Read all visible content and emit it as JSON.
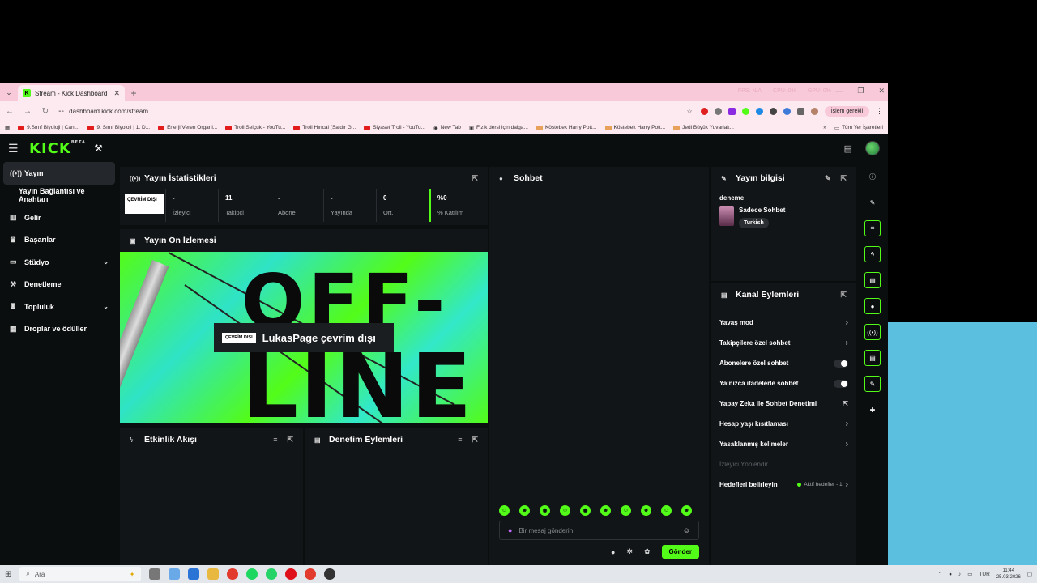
{
  "browser": {
    "tab_title": "Stream - Kick Dashboard",
    "url": "dashboard.kick.com/stream",
    "profile_label": "İşlem gerekli",
    "perf": [
      "FPS: N/A",
      "CPU: 0%",
      "GPU: 0%"
    ],
    "bookmarks": [
      {
        "label": "9.Sınıf Biyoloji | Canl...",
        "icon": "youtube"
      },
      {
        "label": "9. Sınıf Biyoloji | 1. D...",
        "icon": "youtube"
      },
      {
        "label": "Enerji Veren Organi...",
        "icon": "youtube"
      },
      {
        "label": "Troll Selçuk - YouTu...",
        "icon": "youtube"
      },
      {
        "label": "Troll Hıncal (Saldır G...",
        "icon": "youtube"
      },
      {
        "label": "Siyaset Troll - YouTu...",
        "icon": "youtube"
      },
      {
        "label": "New Tab",
        "icon": "chrome"
      },
      {
        "label": "Fizik dersi için dalga...",
        "icon": "doc"
      },
      {
        "label": "Köstebek Harry Pott...",
        "icon": "folder"
      },
      {
        "label": "Köstebek Harry Pott...",
        "icon": "folder"
      },
      {
        "label": "Jedi Büyük Yuvarlak...",
        "icon": "folder"
      }
    ],
    "bookmarks_all": "Tüm Yer İşaretleri"
  },
  "app": {
    "logo": "KICK",
    "logo_badge": "BETA"
  },
  "sidebar": {
    "items": [
      {
        "label": "Yayın",
        "icon": "broadcast-icon"
      },
      {
        "label": "Yayın Bağlantısı ve Anahtarı",
        "icon": ""
      },
      {
        "label": "Gelir",
        "icon": "chart-icon"
      },
      {
        "label": "Başarılar",
        "icon": "trophy-icon"
      },
      {
        "label": "Stüdyo",
        "icon": "studio-icon"
      },
      {
        "label": "Denetleme",
        "icon": "hammer-icon"
      },
      {
        "label": "Topluluk",
        "icon": "community-icon"
      },
      {
        "label": "Droplar ve ödüller",
        "icon": "gift-icon"
      }
    ]
  },
  "stats": {
    "title": "Yayın İstatistikleri",
    "status_badge": "ÇEVRİM DIŞI",
    "items": [
      {
        "value": "-",
        "label": "İzleyici"
      },
      {
        "value": "11",
        "label": "Takipçi"
      },
      {
        "value": "-",
        "label": "Abone"
      },
      {
        "value": "-",
        "label": "Yayında"
      },
      {
        "value": "0",
        "label": "Ort."
      },
      {
        "value": "%0",
        "label": "% Katılım"
      }
    ]
  },
  "preview": {
    "title": "Yayın Ön İzlemesi",
    "chip": "ÇEVRİM DIŞI",
    "offline_text": "LukasPage çevrim dışı",
    "art_top": "OFF-",
    "art_bottom": "LINE"
  },
  "activity": {
    "title": "Etkinlik Akışı"
  },
  "modactions": {
    "title": "Denetim Eylemleri"
  },
  "chat": {
    "title": "Sohbet",
    "placeholder": "Bir mesaj gönderin",
    "send_label": "Gönder"
  },
  "stream_info": {
    "title": "Yayın bilgisi",
    "stream_title": "deneme",
    "category": "Sadece Sohbet",
    "tag": "Turkish"
  },
  "channel_actions": {
    "title": "Kanal Eylemleri",
    "rows": [
      {
        "label": "Yavaş mod",
        "control": "arrow"
      },
      {
        "label": "Takipçilere özel sohbet",
        "control": "arrow"
      },
      {
        "label": "Abonelere özel sohbet",
        "control": "toggle"
      },
      {
        "label": "Yalnızca ifadelerle sohbet",
        "control": "toggle"
      },
      {
        "label": "Yapay Zeka ile Sohbet Denetimi",
        "control": "external"
      },
      {
        "label": "Hesap yaşı kısıtlaması",
        "control": "arrow"
      },
      {
        "label": "Yasaklanmış kelimeler",
        "control": "arrow"
      }
    ],
    "muted_row": "İzleyici Yönlendir",
    "goals_label": "Hedefleri belirleyin",
    "goals_status": "Aktif hedefler - 1"
  },
  "taskbar": {
    "search": "Ara",
    "lang": "TUR",
    "time": "11:44",
    "date": "25.03.2026"
  },
  "colors": {
    "accent": "#53fc18",
    "panel": "#121518",
    "background": "#0b0e0f"
  }
}
